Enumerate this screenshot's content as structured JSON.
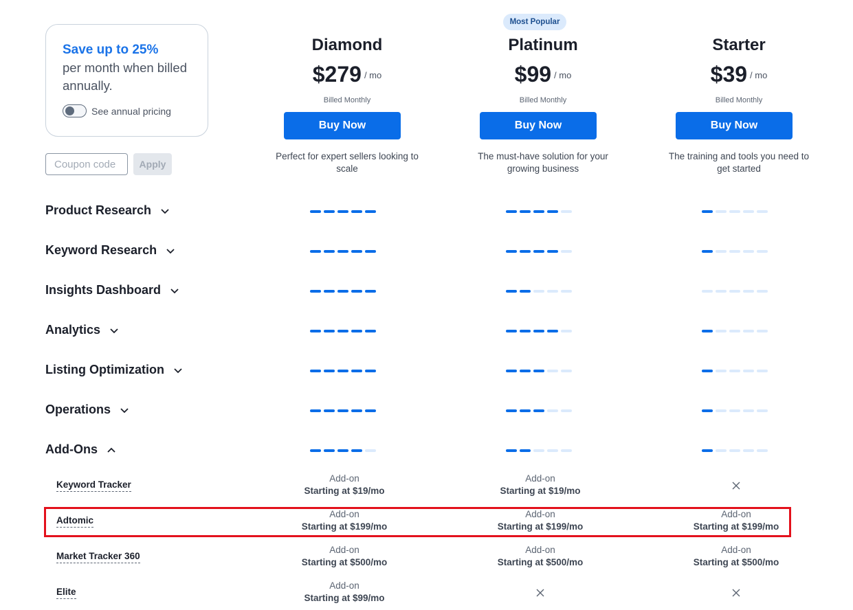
{
  "promo": {
    "headline": "Save up to 25%",
    "body": "per month when billed annually.",
    "toggle_label": "See annual pricing"
  },
  "coupon": {
    "placeholder": "Coupon code",
    "value": "",
    "apply_label": "Apply"
  },
  "plans": [
    {
      "name": "Diamond",
      "price": "$279",
      "per": "/ mo",
      "billing": "Billed Monthly",
      "cta": "Buy Now",
      "description": "Perfect for expert sellers looking to scale",
      "badge": ""
    },
    {
      "name": "Platinum",
      "price": "$99",
      "per": "/ mo",
      "billing": "Billed Monthly",
      "cta": "Buy Now",
      "description": "The must-have solution for your growing business",
      "badge": "Most Popular"
    },
    {
      "name": "Starter",
      "price": "$39",
      "per": "/ mo",
      "billing": "Billed Monthly",
      "cta": "Buy Now",
      "description": "The training and tools you need to get started",
      "badge": ""
    }
  ],
  "features": [
    {
      "label": "Product Research",
      "expanded": false,
      "levels": [
        5,
        4,
        1
      ]
    },
    {
      "label": "Keyword Research",
      "expanded": false,
      "levels": [
        5,
        4,
        1
      ]
    },
    {
      "label": "Insights Dashboard",
      "expanded": false,
      "levels": [
        5,
        2,
        0
      ]
    },
    {
      "label": "Analytics",
      "expanded": false,
      "levels": [
        5,
        4,
        1
      ]
    },
    {
      "label": "Listing Optimization",
      "expanded": false,
      "levels": [
        5,
        3,
        1
      ]
    },
    {
      "label": "Operations",
      "expanded": false,
      "levels": [
        5,
        3,
        1
      ]
    },
    {
      "label": "Add-Ons",
      "expanded": true,
      "levels": [
        4,
        2,
        1
      ]
    }
  ],
  "meter_max": 5,
  "addons": [
    {
      "name": "Keyword Tracker",
      "cells": [
        {
          "line1": "Add-on",
          "line2": "Starting at $19/mo"
        },
        {
          "line1": "Add-on",
          "line2": "Starting at $19/mo"
        },
        null
      ]
    },
    {
      "name": "Adtomic",
      "cells": [
        {
          "line1": "Add-on",
          "line2": "Starting at $199/mo"
        },
        {
          "line1": "Add-on",
          "line2": "Starting at $199/mo"
        },
        {
          "line1": "Add-on",
          "line2": "Starting at $199/mo"
        }
      ]
    },
    {
      "name": "Market Tracker 360",
      "cells": [
        {
          "line1": "Add-on",
          "line2": "Starting at $500/mo"
        },
        {
          "line1": "Add-on",
          "line2": "Starting at $500/mo"
        },
        {
          "line1": "Add-on",
          "line2": "Starting at $500/mo"
        }
      ]
    },
    {
      "name": "Elite",
      "cells": [
        {
          "line1": "Add-on",
          "line2": "Starting at $99/mo"
        },
        null,
        null
      ]
    }
  ],
  "colors": {
    "accent": "#0a6de8",
    "meter_off": "#dbeafc",
    "highlight": "#e3111c"
  },
  "icons": {
    "expand": "chevron-down-icon",
    "collapse": "chevron-up-icon",
    "not_included": "close-icon"
  }
}
